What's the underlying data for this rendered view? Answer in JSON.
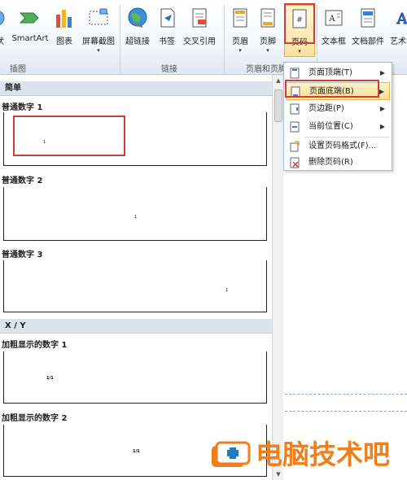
{
  "ribbon": {
    "buttons": {
      "shape_partial": "状",
      "smartart": "SmartArt",
      "chart": "图表",
      "screenshot": "屏幕截图",
      "hyperlink": "超链接",
      "bookmark": "书签",
      "crossref": "交叉引用",
      "header": "页眉",
      "footer": "页脚",
      "pagenum": "页码",
      "textbox": "文本框",
      "quickparts": "文档部件",
      "wordart_partial": "艺术字"
    },
    "dropdown_marker": "▾",
    "groups": {
      "illustrations": "插图",
      "links": "链接",
      "header_footer": "页眉和页脚"
    }
  },
  "gallery": {
    "sections": [
      {
        "heading": "简单"
      },
      {
        "heading": "X / Y"
      }
    ],
    "items": [
      {
        "title": "普通数字 1",
        "sample": "1"
      },
      {
        "title": "普通数字 2",
        "sample": "1"
      },
      {
        "title": "普通数字 3",
        "sample": "1"
      },
      {
        "title": "加粗显示的数字 1",
        "sample": "1/1"
      },
      {
        "title": "加粗显示的数字 2",
        "sample": "1/1"
      }
    ]
  },
  "scrollbar": {
    "up": "▲",
    "down": "▼"
  },
  "menu": {
    "items": [
      {
        "label": "页面顶端(T)",
        "submenu": true
      },
      {
        "label": "页面底端(B)",
        "submenu": true,
        "highlighted": true
      },
      {
        "label": "页边距(P)",
        "submenu": true
      },
      {
        "label": "当前位置(C)",
        "submenu": true
      },
      {
        "label": "设置页码格式(F)...",
        "submenu": false
      },
      {
        "label": "删除页码(R)",
        "submenu": false
      }
    ],
    "arrow": "▶"
  },
  "watermark": {
    "text": "电脑技术吧"
  },
  "colors": {
    "accent_red": "#d23b3b",
    "menu_highlight": "#fbdf91",
    "watermark_orange": "#f07e1b"
  }
}
